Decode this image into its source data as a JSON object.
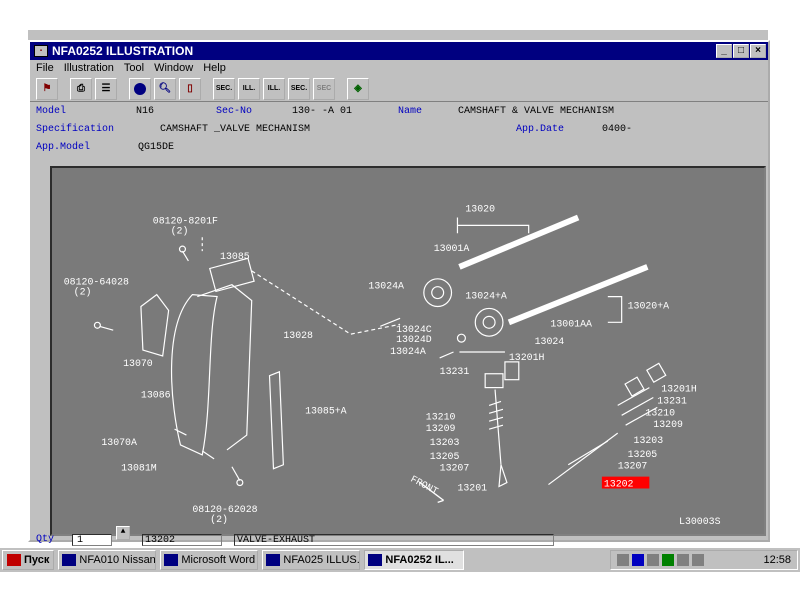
{
  "window": {
    "title": "NFA0252  ILLUSTRATION",
    "controls": [
      "_",
      "□",
      "×"
    ]
  },
  "menu": [
    "File",
    "Illustration",
    "Tool",
    "Window",
    "Help"
  ],
  "toolbar": {
    "buttons": [
      "exit",
      "print",
      "list",
      "ball",
      "search",
      "book",
      "SEC.",
      "ILL.",
      "ILL.",
      "SEC.",
      "SEC",
      "help"
    ]
  },
  "info": {
    "model_label": "Model",
    "model_value": "N16",
    "secno_label": "Sec-No",
    "secno_value": "130-  -A 01",
    "name_label": "Name",
    "name_value": "CAMSHAFT & VALVE MECHANISM",
    "spec_label": "Specification",
    "spec_value": "CAMSHAFT _VALVE MECHANISM",
    "appdate_label": "App.Date",
    "appdate_value": "0400-",
    "appmodel_label": "App.Model",
    "appmodel_value": "QG15DE"
  },
  "illustration": {
    "code": "L30003S",
    "front": "FRONT",
    "highlight": "13202",
    "labels": {
      "b1": "08120-8201F",
      "b1q": "(2)",
      "b2": "08120-64028",
      "b2q": "(2)",
      "b3": "08120-62028",
      "b3q": "(2)",
      "p13085": "13085",
      "p13028": "13028",
      "p13070": "13070",
      "p13086": "13086",
      "p13085a": "13085+A",
      "p13070a": "13070A",
      "p13081m": "13081M",
      "p13020": "13020",
      "p13001a": "13001A",
      "p13024a": "13024A",
      "p13024pa": "13024+A",
      "p13020a": "13020+A",
      "p13001aa": "13001AA",
      "p13024c": "13024C",
      "p13024d": "13024D",
      "p13024": "13024",
      "p13024ax": "13024A",
      "p13201h": "13201H",
      "p13231": "13231",
      "p13201h2": "13201H",
      "p13231b": "13231",
      "p13210": "13210",
      "p13209": "13209",
      "p13210b": "13210",
      "p13209b": "13209",
      "p13203": "13203",
      "p13203b": "13203",
      "p13205": "13205",
      "p13205b": "13205",
      "p13207": "13207",
      "p13207b": "13207",
      "p13201": "13201"
    }
  },
  "qty": {
    "label": "Qty",
    "value": "1",
    "part": "13202",
    "desc": "VALVE-EXHAUST"
  },
  "taskbar": {
    "start": "Пуск",
    "tasks": [
      "NFA010 Nissan...",
      "Microsoft Word",
      "NFA025 ILLUS...",
      "NFA0252  IL..."
    ],
    "clock": "12:58"
  }
}
